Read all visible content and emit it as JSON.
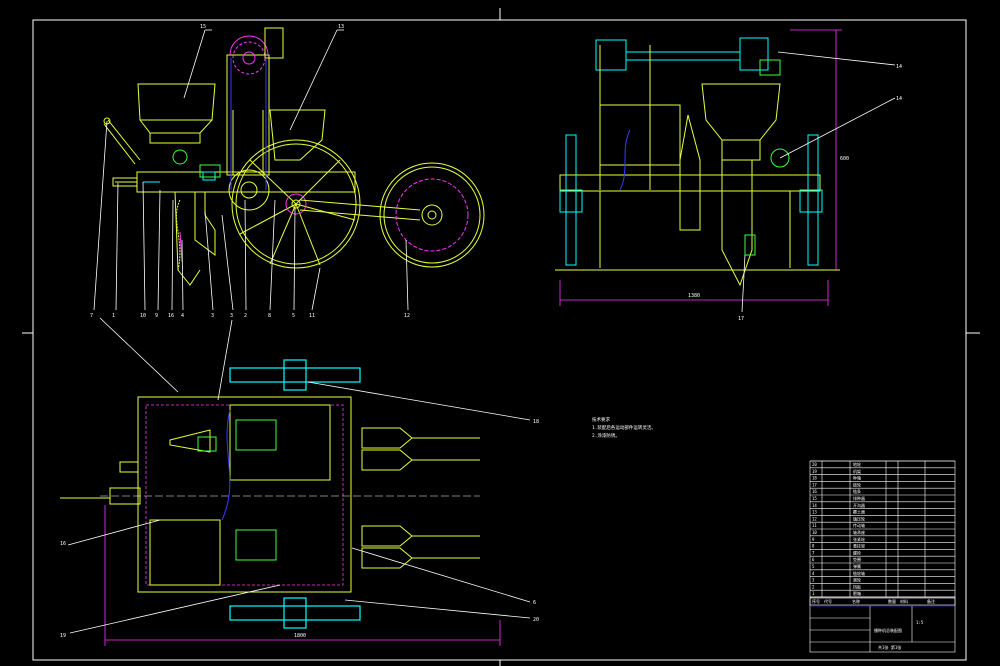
{
  "colors": {
    "background": "#000000",
    "frame": "#ffffff",
    "part_outline": "#e8ff3a",
    "green": "#3cff3c",
    "cyan": "#00ffff",
    "magenta": "#ff33ff",
    "blue": "#3a3aff",
    "red": "#ff3030",
    "leader": "#ffffff"
  },
  "callouts": {
    "front_view_top": [
      "15",
      "13"
    ],
    "front_view_bottom": [
      "7",
      "1",
      "10",
      "9",
      "16",
      "4",
      "3",
      "3",
      "2",
      "8",
      "5",
      "11",
      "12"
    ],
    "side_view": [
      "14",
      "14",
      "17"
    ],
    "plan_view": [
      "18",
      "16",
      "6",
      "19",
      "20"
    ]
  },
  "dimensions": {
    "side_width": "1380",
    "side_height": "600",
    "plan_width": "1800"
  },
  "tech_notes": {
    "heading": "技术要求",
    "lines": [
      "1.装配后各运动部件运转灵活。",
      "2.涂漆防锈。"
    ]
  },
  "title_block": {
    "part_names": [
      "地轮",
      "机架",
      "种箱",
      "链轮",
      "链条",
      "排种器",
      "开沟器",
      "覆土器",
      "镇压轮",
      "传动轴",
      "轴承座",
      "张紧轮",
      "悬挂架",
      "螺栓",
      "垫圈",
      "弹簧",
      "链轮轴",
      "滚轮",
      "挡板",
      "肥箱"
    ],
    "header": [
      "序号",
      "代号",
      "名称",
      "数量",
      "材料",
      "备注"
    ],
    "drawing_title": "播种机总装配图",
    "scale": "1:5",
    "sheet": "共1张 第1张"
  }
}
